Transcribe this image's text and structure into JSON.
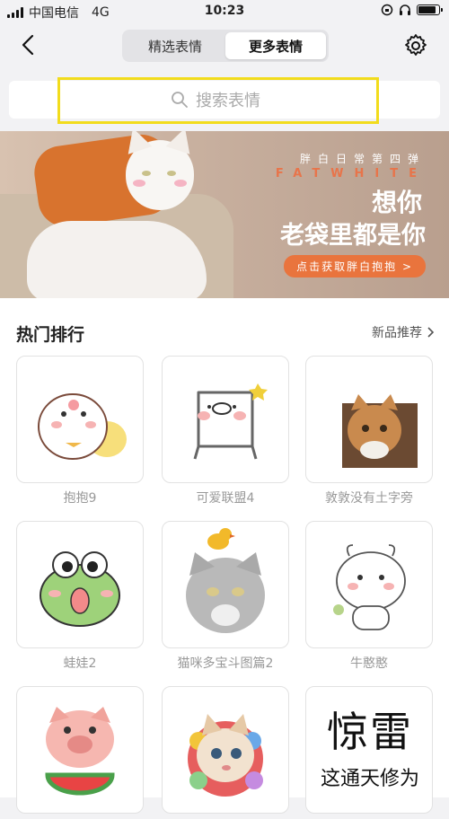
{
  "status": {
    "carrier": "中国电信",
    "network": "4G",
    "time": "10:23",
    "battery_level": 0.85
  },
  "nav": {
    "tabs": [
      {
        "label": "精选表情"
      },
      {
        "label": "更多表情"
      }
    ],
    "active_tab": 1
  },
  "search": {
    "placeholder": "搜索表情"
  },
  "banner": {
    "subtitle": "胖白日常第四弹",
    "english": "FATWHITE",
    "headline1": "想你",
    "headline2": "老袋里都是你",
    "cta": "点击获取胖白抱抱 >"
  },
  "section": {
    "title": "热门排行",
    "more_label": "新品推荐"
  },
  "items": [
    {
      "name": "抱抱9"
    },
    {
      "name": "可爱联盟4"
    },
    {
      "name": "敦敦没有土字旁"
    },
    {
      "name": "蛙娃2"
    },
    {
      "name": "猫咪多宝斗图篇2"
    },
    {
      "name": "牛憨憨"
    },
    {
      "name": ""
    },
    {
      "name": ""
    },
    {
      "name": "",
      "art_text_1": "惊雷",
      "art_text_2": "这通天修为"
    }
  ],
  "colors": {
    "accent": "#e9743d",
    "highlight": "#f2dc1c"
  }
}
